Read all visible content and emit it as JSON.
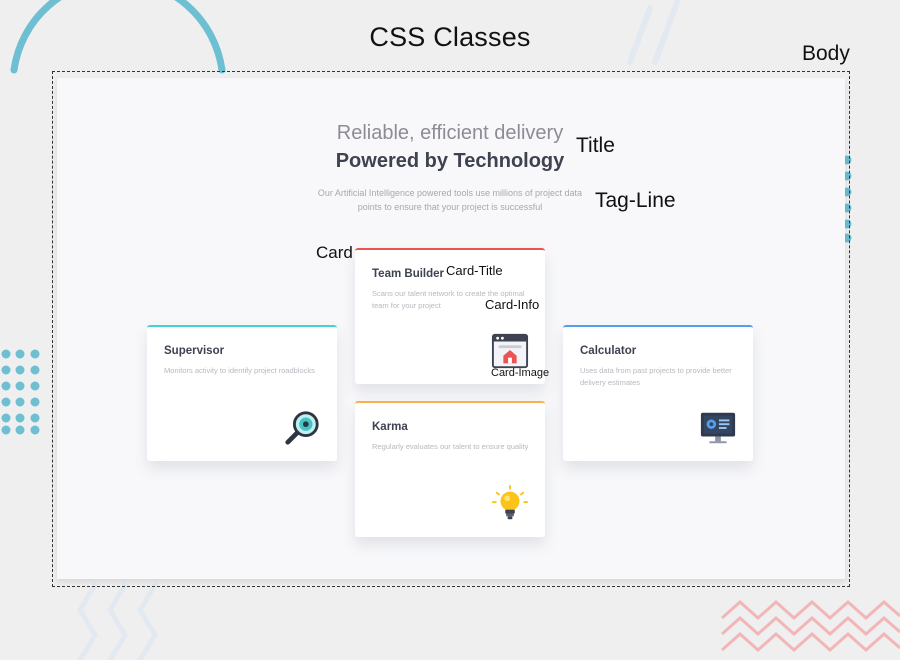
{
  "diagram": {
    "heading": "CSS Classes",
    "labels": {
      "body": "Body",
      "title": "Title",
      "tagline": "Tag-Line",
      "card": "Card",
      "card_title": "Card-Title",
      "card_info": "Card-Info",
      "card_image": "Card-Image"
    }
  },
  "hero": {
    "title_light": "Reliable, efficient delivery",
    "title_bold": "Powered by Technology",
    "tagline_1": "Our Artificial Intelligence powered tools use millions of project data",
    "tagline_2": "points to ensure that your project is successful"
  },
  "cards": [
    {
      "title": "Supervisor",
      "info": "Monitors activity to identify project roadblocks",
      "icon": "magnifier-icon",
      "accent": "#44d3d2"
    },
    {
      "title": "Team Builder",
      "info": "Scans our talent network to create the optimal team for your project",
      "icon": "browser-icon",
      "accent": "#ea5454"
    },
    {
      "title": "Karma",
      "info": "Regularly evaluates our talent to ensure quality",
      "icon": "lightbulb-icon",
      "accent": "#fcaf4a"
    },
    {
      "title": "Calculator",
      "info": "Uses data from past projects to provide better delivery estimates",
      "icon": "monitor-icon",
      "accent": "#549ef2"
    }
  ],
  "colors": {
    "body_bg": "#efeff0",
    "page_bg": "#f8f8fa",
    "heading_dark": "#3e4251",
    "muted_text": "#a7a7b0",
    "deco_teal": "#6dbfd1",
    "deco_pink": "#f2b6b6"
  }
}
